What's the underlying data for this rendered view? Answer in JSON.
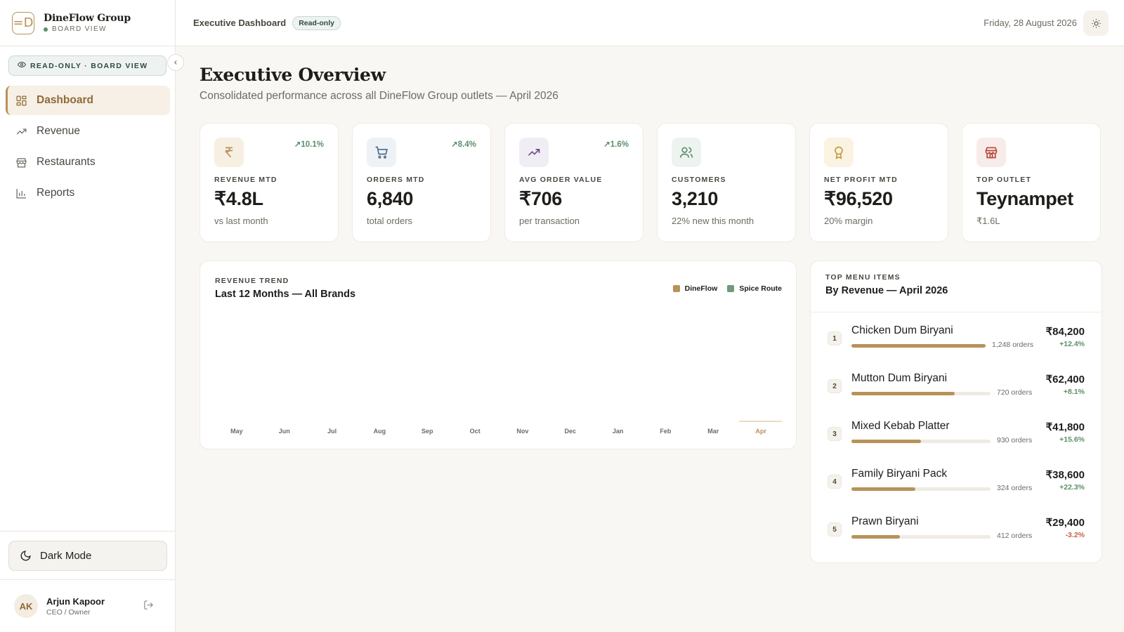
{
  "brand": {
    "logo": "=D",
    "name": "DineFlow Group",
    "sub": "BOARD VIEW"
  },
  "sidebar": {
    "readonly_chip": "READ-ONLY · BOARD VIEW",
    "items": [
      {
        "label": "Dashboard",
        "icon": "dashboard-icon",
        "active": true
      },
      {
        "label": "Revenue",
        "icon": "trend-up-icon",
        "active": false
      },
      {
        "label": "Restaurants",
        "icon": "store-icon",
        "active": false
      },
      {
        "label": "Reports",
        "icon": "bar-chart-icon",
        "active": false
      }
    ],
    "dark_mode_label": "Dark Mode",
    "user": {
      "initials": "AK",
      "name": "Arjun Kapoor",
      "role": "CEO / Owner"
    }
  },
  "header": {
    "title": "Executive Dashboard",
    "badge": "Read-only",
    "date": "Friday, 28 August 2026"
  },
  "main": {
    "title": "Executive Overview",
    "subtitle": "Consolidated performance across all DineFlow Group outlets — April 2026"
  },
  "kpis": [
    {
      "label": "REVENUE MTD",
      "value": "₹4.8L",
      "note": "vs last month",
      "trend": "10.1%",
      "icon": "rupee-icon",
      "accent": "#b8925a",
      "bg": "#f7efe2"
    },
    {
      "label": "ORDERS MTD",
      "value": "6,840",
      "note": "total orders",
      "trend": "8.4%",
      "icon": "cart-icon",
      "accent": "#4d6b8c",
      "bg": "#eef2f6"
    },
    {
      "label": "AVG ORDER VALUE",
      "value": "₹706",
      "note": "per transaction",
      "trend": "1.6%",
      "icon": "trend-up-icon",
      "accent": "#6d4d8c",
      "bg": "#f1edf5"
    },
    {
      "label": "CUSTOMERS",
      "value": "3,210",
      "note": "22% new this month",
      "trend": "",
      "icon": "users-icon",
      "accent": "#5b8f6b",
      "bg": "#edf4ef"
    },
    {
      "label": "NET PROFIT MTD",
      "value": "₹96,520",
      "note": "20% margin",
      "trend": "",
      "icon": "award-icon",
      "accent": "#c59a3e",
      "bg": "#fbf3e2"
    },
    {
      "label": "TOP OUTLET",
      "value": "Teynampet",
      "note": "₹1.6L",
      "trend": "",
      "icon": "store-icon",
      "accent": "#b94a3c",
      "bg": "#f8ecea"
    }
  ],
  "revenue_trend": {
    "eyebrow": "REVENUE TREND",
    "title": "Last 12 Months — All Brands",
    "legend": [
      {
        "name": "DineFlow",
        "color": "#b8925a"
      },
      {
        "name": "Spice Route",
        "color": "#6f9a7c"
      }
    ]
  },
  "chart_data": {
    "type": "bar",
    "title": "Last 12 Months — All Brands",
    "categories": [
      "May",
      "Jun",
      "Jul",
      "Aug",
      "Sep",
      "Oct",
      "Nov",
      "Dec",
      "Jan",
      "Feb",
      "Mar",
      "Apr"
    ],
    "highlight_category": "Apr",
    "series": [
      {
        "name": "DineFlow",
        "values": [
          0,
          0,
          0,
          0,
          0,
          0,
          0,
          0,
          0,
          0,
          0,
          0
        ]
      },
      {
        "name": "Spice Route",
        "values": [
          0,
          0,
          0,
          0,
          0,
          0,
          0,
          0,
          0,
          0,
          0,
          0
        ]
      }
    ],
    "grid": false,
    "legend_position": "top-right"
  },
  "top_menu": {
    "eyebrow": "TOP MENU ITEMS",
    "title": "By Revenue — April 2026",
    "items": [
      {
        "rank": "1",
        "name": "Chicken Dum Biryani",
        "orders": "1,248 orders",
        "amount": "₹84,200",
        "change": "+12.4%",
        "share": 1.0
      },
      {
        "rank": "2",
        "name": "Mutton Dum Biryani",
        "orders": "720 orders",
        "amount": "₹62,400",
        "change": "+8.1%",
        "share": 0.74
      },
      {
        "rank": "3",
        "name": "Mixed Kebab Platter",
        "orders": "930 orders",
        "amount": "₹41,800",
        "change": "+15.6%",
        "share": 0.5
      },
      {
        "rank": "4",
        "name": "Family Biryani Pack",
        "orders": "324 orders",
        "amount": "₹38,600",
        "change": "+22.3%",
        "share": 0.46
      },
      {
        "rank": "5",
        "name": "Prawn Biryani",
        "orders": "412 orders",
        "amount": "₹29,400",
        "change": "-3.2%",
        "share": 0.35
      }
    ]
  }
}
